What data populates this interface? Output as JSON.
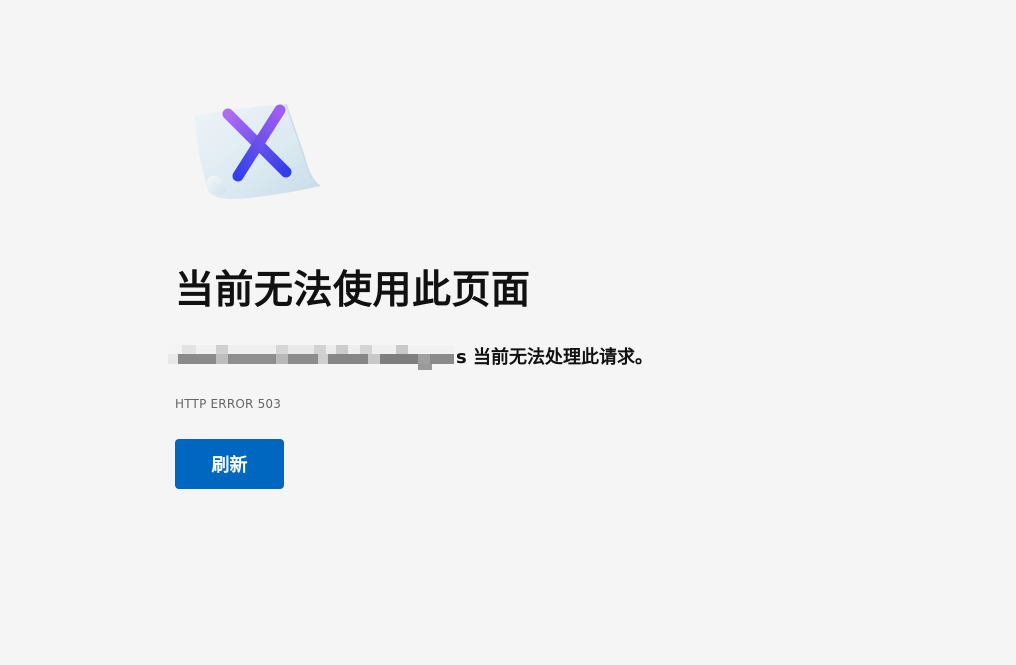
{
  "page": {
    "title": "当前无法使用此页面",
    "message_host": "",
    "message_suffix": "s 当前无法处理此请求。",
    "error_code": "HTTP ERROR 503",
    "refresh_label": "刷新"
  },
  "icons": {
    "error": "error-document-x-icon"
  },
  "colors": {
    "background": "#f5f5f5",
    "button": "#0067c0",
    "button_text": "#ffffff",
    "title": "#111111",
    "code": "#666666",
    "x_mark_top": "#a35df0",
    "x_mark_bottom": "#2f3fe8"
  }
}
